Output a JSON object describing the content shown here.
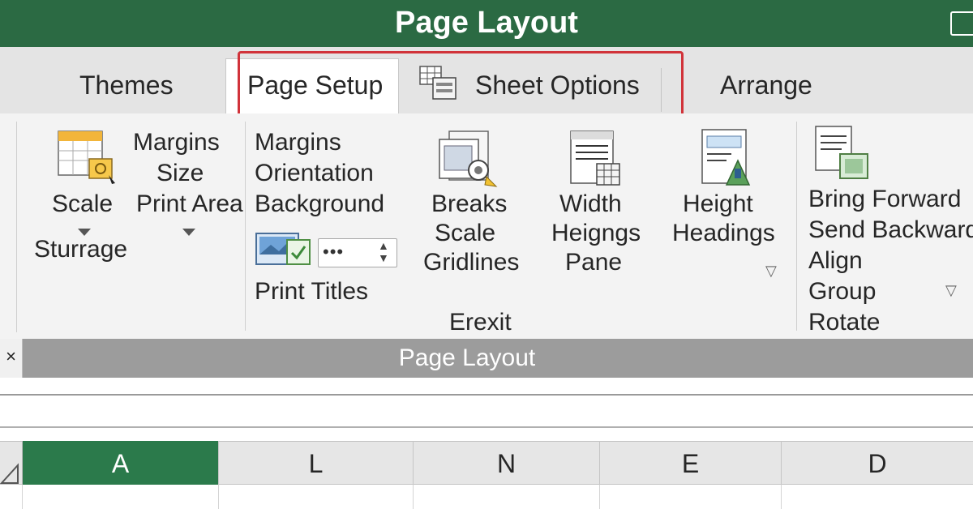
{
  "window": {
    "title": "Page Layout"
  },
  "tabs": [
    {
      "label": "Themes"
    },
    {
      "label": "Page Setup"
    },
    {
      "label": "Sheet Options"
    },
    {
      "label": "Arrange"
    }
  ],
  "ribbon": {
    "themes_group": {
      "scale": "Scale",
      "margins": "Margins",
      "size": "Size",
      "print_area": "Print Area",
      "storage": "Sturrage"
    },
    "page_setup_group": {
      "margins": "Margins",
      "orientation": "Orientation",
      "background": "Background",
      "print_titles": "Print Titles",
      "dropdown_value": "•••"
    },
    "sheet_options_group": {
      "breaks": "Breaks",
      "scale": "Scale",
      "gridlines": "Gridlines",
      "width": "Width",
      "heigngs": "Heigngs",
      "pane": "Pane",
      "height": "Height",
      "headings": "Headings",
      "group_label": "Erexit"
    },
    "arrange_group": {
      "bring_forward": "Bring Forward",
      "send_backward": "Send Backward",
      "align": "Align",
      "group": "Group",
      "rotate": "Rotate"
    },
    "bottom_label": "Page Layout",
    "close_symbol": "×"
  },
  "grid": {
    "columns": [
      "A",
      "L",
      "N",
      "E",
      "D"
    ],
    "selected_column": "A",
    "colors": {
      "selected": "#2b7a4b",
      "header": "#e6e6e6",
      "title_bar": "#2b6a43",
      "highlight": "#d1333a"
    }
  }
}
